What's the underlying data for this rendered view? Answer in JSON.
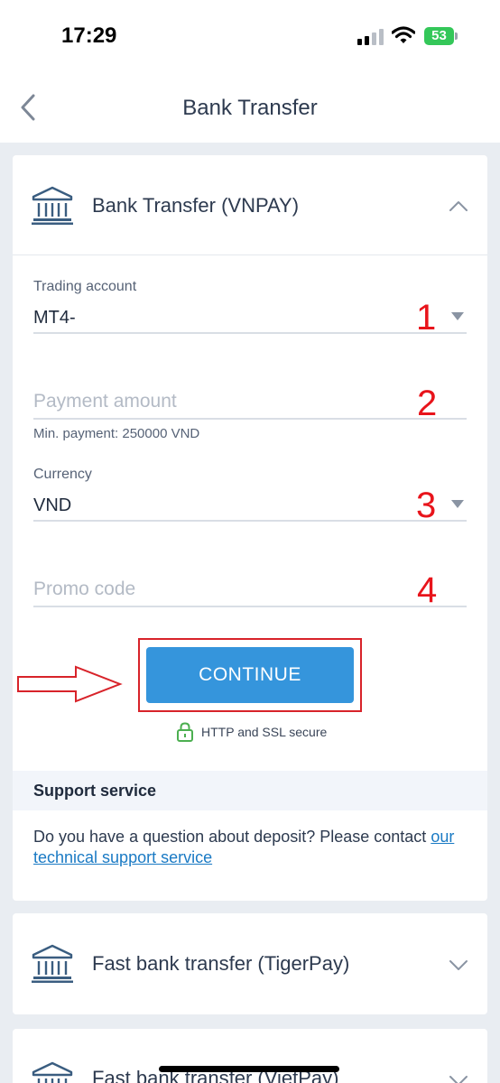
{
  "status_bar": {
    "time": "17:29",
    "battery_level": "53",
    "battery_color": "#34c759",
    "icons": [
      "signal-icon",
      "wifi-icon",
      "battery-icon"
    ]
  },
  "nav": {
    "back_icon": "chevron-left-icon",
    "title": "Bank Transfer"
  },
  "method": {
    "icon": "bank-icon",
    "title": "Bank Transfer (VNPAY)",
    "expanded": true,
    "toggle_icon": "chevron-up-icon"
  },
  "form": {
    "trading_account": {
      "label": "Trading account",
      "value": "MT4-",
      "arrow_icon": "caret-down-icon"
    },
    "payment_amount": {
      "placeholder": "Payment amount",
      "value": "",
      "hint": "Min. payment: 250000 VND"
    },
    "currency": {
      "label": "Currency",
      "value": "VND",
      "arrow_icon": "caret-down-icon"
    },
    "promo_code": {
      "placeholder": "Promo code",
      "value": ""
    },
    "continue_label": "CONTINUE",
    "secure_icon": "lock-icon",
    "secure_text": "HTTP and SSL secure"
  },
  "annotations": {
    "step_numbers": [
      "1",
      "2",
      "3",
      "4"
    ],
    "color": "#e8141b",
    "arrow_icon": "right-arrow-outline-icon"
  },
  "support": {
    "title": "Support service",
    "text": "Do you have a question about deposit? Please contact ",
    "link": "our technical support service"
  },
  "other_methods": [
    {
      "icon": "bank-icon",
      "title": "Fast bank transfer (TigerPay)",
      "toggle_icon": "chevron-down-icon"
    },
    {
      "icon": "bank-icon",
      "title": "Fast bank transfer (VietPay)",
      "toggle_icon": "chevron-down-icon"
    }
  ],
  "colors": {
    "accent": "#3595dc",
    "link": "#1a7ac4",
    "background": "#e9edf2",
    "annotation_red": "#e8141b"
  }
}
